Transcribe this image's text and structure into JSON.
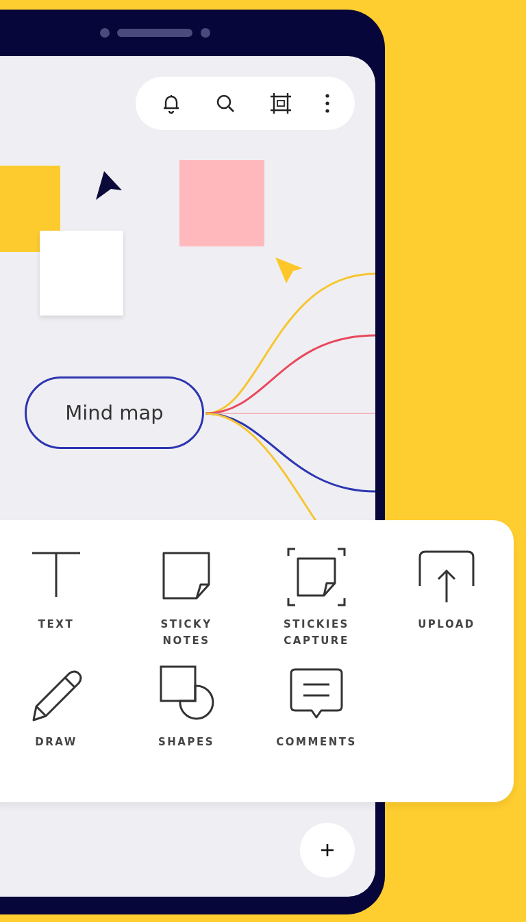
{
  "canvas": {
    "mind_map_node": {
      "label": "Mind map"
    }
  },
  "tools": [
    {
      "kind": "text",
      "label": "TEXT"
    },
    {
      "kind": "sticky",
      "label": "STICKY NOTES"
    },
    {
      "kind": "capture",
      "label": "STICKIES CAPTURE"
    },
    {
      "kind": "upload",
      "label": "UPLOAD"
    },
    {
      "kind": "draw",
      "label": "DRAW"
    },
    {
      "kind": "shapes",
      "label": "SHAPES"
    },
    {
      "kind": "comments",
      "label": "COMMENTS"
    }
  ]
}
